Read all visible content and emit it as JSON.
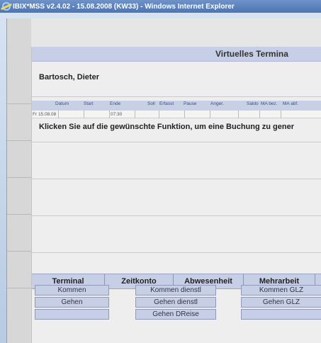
{
  "window": {
    "title": "IBIX*MSS v2.4.02 - 15.08.2008 (KW33) - Windows Internet Explorer"
  },
  "terminal": {
    "title": "Virtuelles Termina",
    "employee_name": "Bartosch, Dieter",
    "prompt": "Klicken Sie auf die gewünschte Funktion, um eine Buchung zu gener"
  },
  "table": {
    "columns": [
      "Datum",
      "Start",
      "Ende",
      "Soll",
      "Erfasst",
      "Pause",
      "Anger.",
      "Saldo",
      "MA bez.",
      "MA abf."
    ],
    "rows": [
      [
        "Fr 15.08.08",
        "",
        "",
        "07:30",
        "",
        "",
        "",
        "",
        "",
        ""
      ]
    ]
  },
  "tabs": [
    "Terminal",
    "Zeitkonto",
    "Abwesenheit",
    "Mehrarbeit"
  ],
  "buttons": {
    "kommen": "Kommen",
    "gehen": "Gehen",
    "kommen_dienstl": "Kommen dienstl",
    "gehen_dienstl": "Gehen dienstl",
    "gehen_dreise": "Gehen DReise",
    "kommen_glz": "Kommen GLZ",
    "gehen_glz": "Gehen GLZ"
  },
  "colors": {
    "accent": "#c7cfe7",
    "titlebar": "#4d74b3"
  }
}
